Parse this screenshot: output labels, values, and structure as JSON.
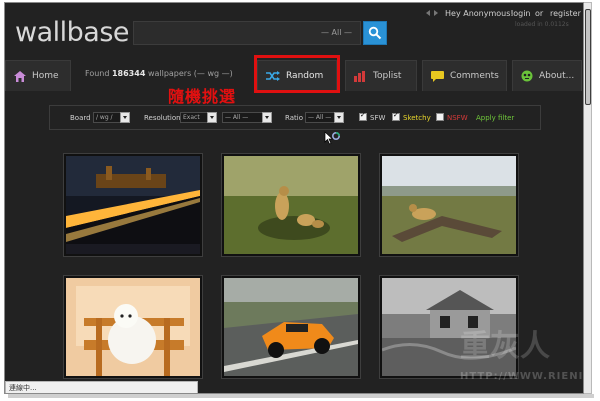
{
  "header": {
    "logo": "wallbase",
    "search": {
      "placeholder": "",
      "scope": "— All —"
    },
    "user": {
      "greeting": "Hey Anonymous!",
      "login": "login",
      "or": "or",
      "register": "register",
      "loaded": "loaded in 0.0112s"
    }
  },
  "nav": {
    "home": "Home",
    "found": {
      "prefix": "Found",
      "count": "186344",
      "suffix": "wallpapers (— wg —)"
    },
    "random": "Random",
    "toplist": "Toplist",
    "comments": "Comments",
    "about": "About..."
  },
  "annotation": "隨機挑選",
  "filters": {
    "board": {
      "label": "Board",
      "value": "/ wg /"
    },
    "resolution": {
      "label": "Resolution",
      "mode": "Exact",
      "value": "— All —"
    },
    "ratio": {
      "label": "Ratio",
      "value": "— All —"
    },
    "sfw": {
      "label": "SFW",
      "checked": true
    },
    "sketchy": {
      "label": "Sketchy",
      "checked": true,
      "color": "#e8d62c"
    },
    "nsfw": {
      "label": "NSFW",
      "checked": false,
      "color": "#d63a3a"
    },
    "apply": {
      "label": "Apply filter",
      "color": "#6fc63a"
    }
  },
  "thumbnails": [
    {
      "subject": "city-bridge-night"
    },
    {
      "subject": "cheetahs-on-grass"
    },
    {
      "subject": "cheetah-on-logs"
    },
    {
      "subject": "white-puppy-on-chair"
    },
    {
      "subject": "orange-sports-car"
    },
    {
      "subject": "abandoned-house"
    }
  ],
  "status": "連線中...",
  "watermark": {
    "text": "重灰人",
    "url": "HTTP://WWW.RIENIAN.COM"
  },
  "colors": {
    "accent": "#2a92d6",
    "highlight": "#e01010",
    "background": "#222222"
  }
}
